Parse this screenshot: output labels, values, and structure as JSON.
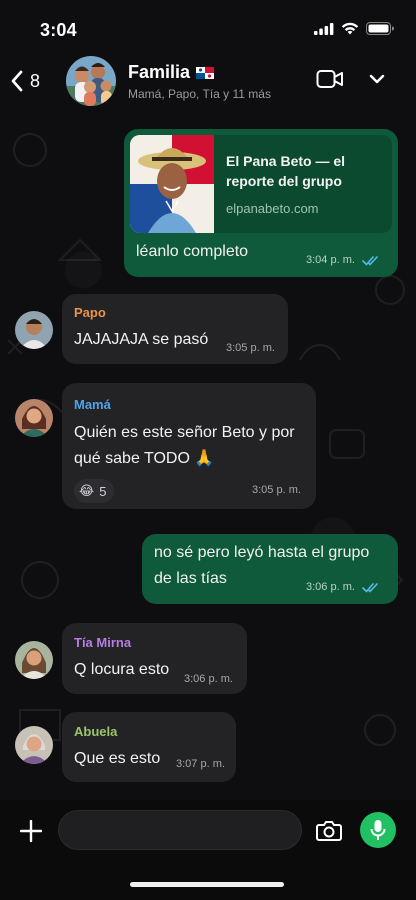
{
  "status_bar": {
    "time": "3:04"
  },
  "header": {
    "back_count": "8",
    "group_name": "Familia",
    "group_flag": "🇵🇦",
    "members": "Mamá, Papo, Tía y 11 más"
  },
  "messages": [
    {
      "id": "m1",
      "direction": "outgoing",
      "link_preview": {
        "title": "El Pana Beto — el reporte del grupo",
        "domain": "elpanabeto.com"
      },
      "text": "léanlo completo",
      "time": "3:04 p. m.",
      "read": true
    },
    {
      "id": "m2",
      "direction": "incoming",
      "sender": "Papo",
      "sender_color": "#e8924a",
      "text": "JAJAJAJA se pasó",
      "time": "3:05 p. m."
    },
    {
      "id": "m3",
      "direction": "incoming",
      "sender": "Mamá",
      "sender_color": "#4fa3e6",
      "text_line1": "Quién es este señor Beto y por",
      "text_line2": "qué sabe TODO 🙏",
      "time": "3:05 p. m.",
      "reaction": {
        "emoji": "😂",
        "count": "5"
      }
    },
    {
      "id": "m4",
      "direction": "outgoing",
      "text_line1": "no sé pero leyó hasta el grupo",
      "text_line2": "de las tías",
      "time": "3:06 p. m.",
      "read": true
    },
    {
      "id": "m5",
      "direction": "incoming",
      "sender": "Tía Mirna",
      "sender_color": "#b37fe0",
      "text": "Q locura esto",
      "time": "3:06 p. m."
    },
    {
      "id": "m6",
      "direction": "incoming",
      "sender": "Abuela",
      "sender_color": "#9cc46a",
      "text": "Que es esto",
      "time": "3:07 p. m."
    }
  ],
  "colors": {
    "outgoing_bubble": "#0f5a3a",
    "incoming_bubble": "#232326",
    "accent_green": "#21c063",
    "read_ticks": "#53bdeb"
  },
  "composer": {
    "placeholder": ""
  }
}
